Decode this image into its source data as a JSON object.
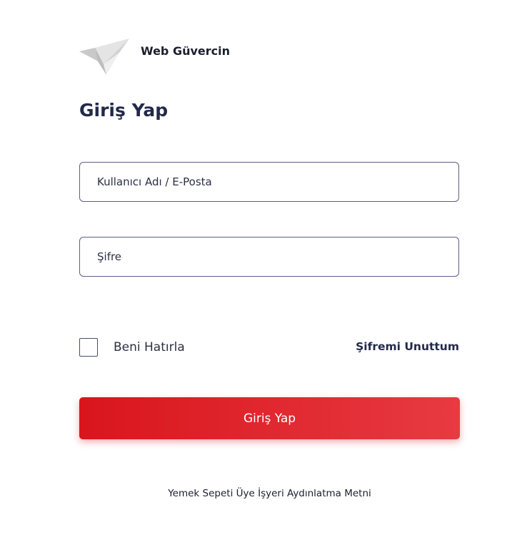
{
  "brand": {
    "name": "Web Güvercin",
    "logo_icon": "pigeon-logo-icon"
  },
  "login": {
    "title": "Giriş Yap",
    "username_placeholder": "Kullanıcı Adı / E-Posta",
    "username_value": "",
    "password_placeholder": "Şifre",
    "password_value": "",
    "remember_label": "Beni Hatırla",
    "remember_checked": false,
    "forgot_label": "Şifremi Unuttum",
    "submit_label": "Giriş Yap"
  },
  "footer": {
    "link_label": "Yemek Sepeti Üye İşyeri Aydınlatma Metni"
  },
  "colors": {
    "primary_red": "#d9151c",
    "primary_red_light": "#e83a42",
    "heading_navy": "#23294a",
    "border": "#5a5f85"
  }
}
